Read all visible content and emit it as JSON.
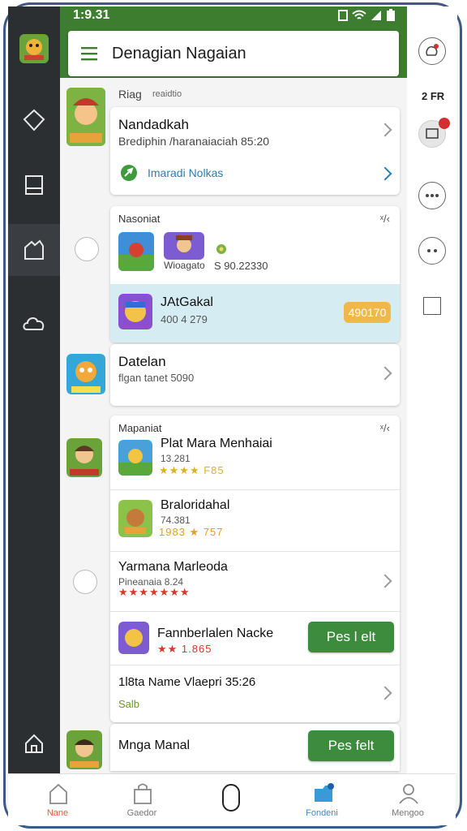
{
  "status": {
    "time": "1:9.31"
  },
  "appbar": {
    "title": "Denagian Nagaian"
  },
  "header_section": {
    "label": "Riag",
    "sub": "reaidtio"
  },
  "card1": {
    "title": "Nandadkah",
    "subtitle": "Brediphin /haranaiaciah 85:20",
    "link": "Imaradi Nolkas"
  },
  "card2": {
    "header": "Nasoniat",
    "tag": "ˣ/‹",
    "price": "S 90.22330",
    "item_label": "Wioagato",
    "highlight": {
      "title": "JAtGakal",
      "subtitle": "400 4 279",
      "pill": "490170"
    }
  },
  "card3": {
    "title": "Datelan",
    "subtitle": "flgan tanet 5090"
  },
  "card4": {
    "header": "Mapaniat",
    "tag": "ˣ/‹",
    "items": [
      {
        "title": "Plat Mara Menhaiai",
        "meta": "13.281",
        "rating": "★★★★ F85"
      },
      {
        "title": "Braloridahal",
        "meta": "74.381",
        "rating": "1983 ★ 757"
      },
      {
        "title": "Yarmana Marleoda",
        "meta": "Pineanaia 8.24",
        "rating": "★★★★★★★"
      },
      {
        "title": "Fannberlalen Nacke",
        "rating": "★★ 1.865",
        "button": "Pes l elt"
      },
      {
        "title": "1l8ta Name Vlaepri 35:26",
        "meta": "Salb"
      }
    ]
  },
  "last_row": {
    "title": "Mnga Manal",
    "button": "Pes felt"
  },
  "right_rail": {
    "label": "2 FR"
  },
  "bottom_nav": [
    {
      "label": "Nane",
      "icon": "home-icon",
      "active": true
    },
    {
      "label": "Gaedor",
      "icon": "bag-icon"
    },
    {
      "label": "",
      "icon": "center-oval-icon"
    },
    {
      "label": "Fondeni",
      "icon": "folder-icon"
    },
    {
      "label": "Mengoo",
      "icon": "profile-icon"
    }
  ],
  "colors": {
    "brand_green": "#3d7d2f",
    "accent_orange": "#f0b848",
    "button_green": "#3d8b3d",
    "highlight_blue": "#d6ecf3"
  }
}
